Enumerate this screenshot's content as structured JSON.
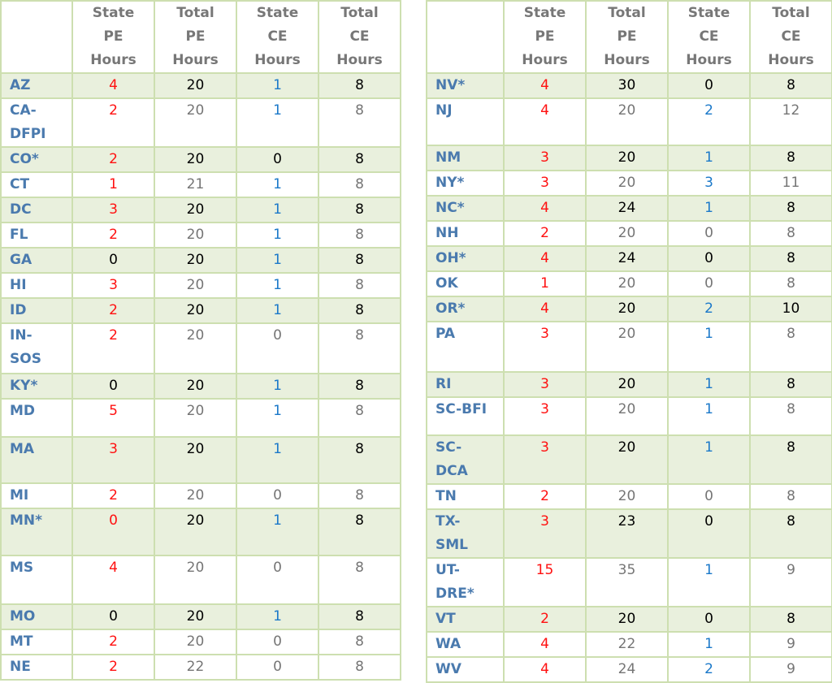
{
  "headers": [
    "",
    "State PE Hours",
    "Total PE Hours",
    "State CE Hours",
    "Total CE Hours"
  ],
  "header_lines": [
    [],
    [
      "State",
      "PE",
      "Hours"
    ],
    [
      "Total",
      "PE",
      "Hours"
    ],
    [
      "State",
      "CE",
      "Hours"
    ],
    [
      "Total",
      "CE",
      "Hours"
    ]
  ],
  "colors": {
    "state_label": "#4a7aae",
    "header_text": "#777777",
    "red": "#ff1010",
    "blue": "#1a78c9",
    "black": "#000000",
    "gray": "#757575",
    "shaded_row": "#e9f0dd",
    "border": "#cddfb0"
  },
  "left_table": {
    "rows": [
      {
        "state": [
          "AZ"
        ],
        "state_pe": "4",
        "total_pe": "20",
        "state_ce": "1",
        "total_ce": "8",
        "shaded": true,
        "h": 30,
        "colors": [
          "red",
          "black",
          "blue",
          "black"
        ]
      },
      {
        "state": [
          "CA-",
          "DFPI"
        ],
        "state_pe": "2",
        "total_pe": "20",
        "state_ce": "1",
        "total_ce": "8",
        "shaded": false,
        "h": 58,
        "colors": [
          "red",
          "gray",
          "blue",
          "gray"
        ]
      },
      {
        "state": [
          "CO*"
        ],
        "state_pe": "2",
        "total_pe": "20",
        "state_ce": "0",
        "total_ce": "8",
        "shaded": true,
        "h": 30,
        "colors": [
          "red",
          "black",
          "black",
          "black"
        ]
      },
      {
        "state": [
          "CT"
        ],
        "state_pe": "1",
        "total_pe": "21",
        "state_ce": "1",
        "total_ce": "8",
        "shaded": false,
        "h": 30,
        "colors": [
          "red",
          "gray",
          "blue",
          "gray"
        ]
      },
      {
        "state": [
          "DC"
        ],
        "state_pe": "3",
        "total_pe": "20",
        "state_ce": "1",
        "total_ce": "8",
        "shaded": true,
        "h": 30,
        "colors": [
          "red",
          "black",
          "blue",
          "black"
        ]
      },
      {
        "state": [
          "FL"
        ],
        "state_pe": "2",
        "total_pe": "20",
        "state_ce": "1",
        "total_ce": "8",
        "shaded": false,
        "h": 30,
        "colors": [
          "red",
          "gray",
          "blue",
          "gray"
        ]
      },
      {
        "state": [
          "GA"
        ],
        "state_pe": "0",
        "total_pe": "20",
        "state_ce": "1",
        "total_ce": "8",
        "shaded": true,
        "h": 30,
        "colors": [
          "black",
          "black",
          "blue",
          "black"
        ]
      },
      {
        "state": [
          "HI"
        ],
        "state_pe": "3",
        "total_pe": "20",
        "state_ce": "1",
        "total_ce": "8",
        "shaded": false,
        "h": 30,
        "colors": [
          "red",
          "gray",
          "blue",
          "gray"
        ]
      },
      {
        "state": [
          "ID"
        ],
        "state_pe": "2",
        "total_pe": "20",
        "state_ce": "1",
        "total_ce": "8",
        "shaded": true,
        "h": 30,
        "colors": [
          "red",
          "black",
          "blue",
          "black"
        ]
      },
      {
        "state": [
          "IN-",
          "SOS"
        ],
        "state_pe": "2",
        "total_pe": "20",
        "state_ce": "0",
        "total_ce": "8",
        "shaded": false,
        "h": 62,
        "colors": [
          "red",
          "gray",
          "gray",
          "gray"
        ]
      },
      {
        "state": [
          "KY*"
        ],
        "state_pe": "0",
        "total_pe": "20",
        "state_ce": "1",
        "total_ce": "8",
        "shaded": true,
        "h": 30,
        "colors": [
          "black",
          "black",
          "blue",
          "black"
        ]
      },
      {
        "state": [
          "MD"
        ],
        "state_pe": "5",
        "total_pe": "20",
        "state_ce": "1",
        "total_ce": "8",
        "shaded": false,
        "h": 47,
        "colors": [
          "red",
          "gray",
          "blue",
          "gray"
        ]
      },
      {
        "state": [
          "MA"
        ],
        "state_pe": "3",
        "total_pe": "20",
        "state_ce": "1",
        "total_ce": "8",
        "shaded": true,
        "h": 57,
        "colors": [
          "red",
          "black",
          "blue",
          "black"
        ]
      },
      {
        "state": [
          "MI"
        ],
        "state_pe": "2",
        "total_pe": "20",
        "state_ce": "0",
        "total_ce": "8",
        "shaded": false,
        "h": 30,
        "colors": [
          "red",
          "gray",
          "gray",
          "gray"
        ]
      },
      {
        "state": [
          "MN*"
        ],
        "state_pe": "0",
        "total_pe": "20",
        "state_ce": "1",
        "total_ce": "8",
        "shaded": true,
        "h": 58,
        "colors": [
          "red",
          "black",
          "blue",
          "black"
        ]
      },
      {
        "state": [
          "MS"
        ],
        "state_pe": "4",
        "total_pe": "20",
        "state_ce": "0",
        "total_ce": "8",
        "shaded": false,
        "h": 60,
        "colors": [
          "red",
          "gray",
          "gray",
          "gray"
        ]
      },
      {
        "state": [
          "MO"
        ],
        "state_pe": "0",
        "total_pe": "20",
        "state_ce": "1",
        "total_ce": "8",
        "shaded": true,
        "h": 30,
        "colors": [
          "black",
          "black",
          "blue",
          "black"
        ]
      },
      {
        "state": [
          "MT"
        ],
        "state_pe": "2",
        "total_pe": "20",
        "state_ce": "0",
        "total_ce": "8",
        "shaded": false,
        "h": 30,
        "colors": [
          "red",
          "gray",
          "gray",
          "gray"
        ]
      },
      {
        "state": [
          "NE"
        ],
        "state_pe": "2",
        "total_pe": "22",
        "state_ce": "0",
        "total_ce": "8",
        "shaded": false,
        "h": 29,
        "colors": [
          "red",
          "gray",
          "gray",
          "gray"
        ]
      }
    ]
  },
  "right_table": {
    "rows": [
      {
        "state": [
          "NV*"
        ],
        "state_pe": "4",
        "total_pe": "30",
        "state_ce": "0",
        "total_ce": "8",
        "shaded": true,
        "h": 30,
        "colors": [
          "red",
          "black",
          "black",
          "black"
        ]
      },
      {
        "state": [
          "NJ"
        ],
        "state_pe": "4",
        "total_pe": "20",
        "state_ce": "2",
        "total_ce": "12",
        "shaded": false,
        "h": 58,
        "colors": [
          "red",
          "gray",
          "blue",
          "gray"
        ]
      },
      {
        "state": [
          "NM"
        ],
        "state_pe": "3",
        "total_pe": "20",
        "state_ce": "1",
        "total_ce": "8",
        "shaded": true,
        "h": 30,
        "colors": [
          "red",
          "black",
          "blue",
          "black"
        ]
      },
      {
        "state": [
          "NY*"
        ],
        "state_pe": "3",
        "total_pe": "20",
        "state_ce": "3",
        "total_ce": "11",
        "shaded": false,
        "h": 30,
        "colors": [
          "red",
          "gray",
          "blue",
          "gray"
        ]
      },
      {
        "state": [
          "NC*"
        ],
        "state_pe": "4",
        "total_pe": "24",
        "state_ce": "1",
        "total_ce": "8",
        "shaded": true,
        "h": 30,
        "colors": [
          "red",
          "black",
          "blue",
          "black"
        ]
      },
      {
        "state": [
          "NH"
        ],
        "state_pe": "2",
        "total_pe": "20",
        "state_ce": "0",
        "total_ce": "8",
        "shaded": false,
        "h": 30,
        "colors": [
          "red",
          "gray",
          "gray",
          "gray"
        ]
      },
      {
        "state": [
          "OH*"
        ],
        "state_pe": "4",
        "total_pe": "24",
        "state_ce": "0",
        "total_ce": "8",
        "shaded": true,
        "h": 30,
        "colors": [
          "red",
          "black",
          "black",
          "black"
        ]
      },
      {
        "state": [
          "OK"
        ],
        "state_pe": "1",
        "total_pe": "20",
        "state_ce": "0",
        "total_ce": "8",
        "shaded": false,
        "h": 30,
        "colors": [
          "red",
          "gray",
          "gray",
          "gray"
        ]
      },
      {
        "state": [
          "OR*"
        ],
        "state_pe": "4",
        "total_pe": "20",
        "state_ce": "2",
        "total_ce": "10",
        "shaded": true,
        "h": 30,
        "colors": [
          "red",
          "black",
          "blue",
          "black"
        ]
      },
      {
        "state": [
          "PA"
        ],
        "state_pe": "3",
        "total_pe": "20",
        "state_ce": "1",
        "total_ce": "8",
        "shaded": false,
        "h": 62,
        "colors": [
          "red",
          "gray",
          "blue",
          "gray"
        ]
      },
      {
        "state": [
          "RI"
        ],
        "state_pe": "3",
        "total_pe": "20",
        "state_ce": "1",
        "total_ce": "8",
        "shaded": true,
        "h": 30,
        "colors": [
          "red",
          "black",
          "blue",
          "black"
        ]
      },
      {
        "state": [
          "SC-BFI"
        ],
        "state_pe": "3",
        "total_pe": "20",
        "state_ce": "1",
        "total_ce": "8",
        "shaded": false,
        "h": 47,
        "colors": [
          "red",
          "gray",
          "blue",
          "gray"
        ]
      },
      {
        "state": [
          "SC-",
          "DCA"
        ],
        "state_pe": "3",
        "total_pe": "20",
        "state_ce": "1",
        "total_ce": "8",
        "shaded": true,
        "h": 57,
        "colors": [
          "red",
          "black",
          "blue",
          "black"
        ]
      },
      {
        "state": [
          "TN"
        ],
        "state_pe": "2",
        "total_pe": "20",
        "state_ce": "0",
        "total_ce": "8",
        "shaded": false,
        "h": 30,
        "colors": [
          "red",
          "gray",
          "gray",
          "gray"
        ]
      },
      {
        "state": [
          "TX-",
          "SML"
        ],
        "state_pe": "3",
        "total_pe": "23",
        "state_ce": "0",
        "total_ce": "8",
        "shaded": true,
        "h": 58,
        "colors": [
          "red",
          "black",
          "black",
          "black"
        ]
      },
      {
        "state": [
          "UT-",
          "DRE*"
        ],
        "state_pe": "15",
        "total_pe": "35",
        "state_ce": "1",
        "total_ce": "9",
        "shaded": false,
        "h": 60,
        "colors": [
          "red",
          "gray",
          "blue",
          "gray"
        ]
      },
      {
        "state": [
          "VT"
        ],
        "state_pe": "2",
        "total_pe": "20",
        "state_ce": "0",
        "total_ce": "8",
        "shaded": true,
        "h": 30,
        "colors": [
          "red",
          "black",
          "black",
          "black"
        ]
      },
      {
        "state": [
          "WA"
        ],
        "state_pe": "4",
        "total_pe": "22",
        "state_ce": "1",
        "total_ce": "9",
        "shaded": false,
        "h": 30,
        "colors": [
          "red",
          "gray",
          "blue",
          "gray"
        ]
      },
      {
        "state": [
          "WV"
        ],
        "state_pe": "4",
        "total_pe": "24",
        "state_ce": "2",
        "total_ce": "9",
        "shaded": false,
        "h": 29,
        "colors": [
          "red",
          "gray",
          "blue",
          "gray"
        ]
      }
    ]
  }
}
